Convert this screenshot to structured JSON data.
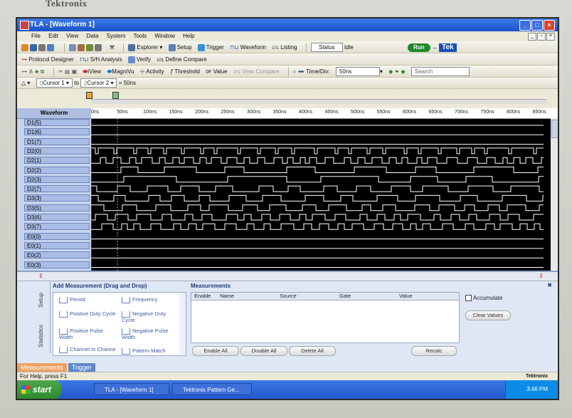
{
  "brand": "Tektronix",
  "window": {
    "title": "TLA - [Waveform 1]"
  },
  "menu": [
    "File",
    "Edit",
    "View",
    "Data",
    "System",
    "Tools",
    "Window",
    "Help"
  ],
  "toolbar1": {
    "explorer": "Explorer",
    "setup": "Setup",
    "trigger": "Trigger",
    "waveform": "Waveform",
    "listing": "Listing",
    "status_label": "Status",
    "status_value": "Idle",
    "run": "Run",
    "tek": "Tek"
  },
  "toolbar2": {
    "protocol": "Protocol Designer",
    "sh_analysis": "S/H Analysis",
    "verify": "Verify",
    "define_compare": "Define Compare"
  },
  "toolbar3": {
    "view": "iView",
    "magnivu": "MagniVu",
    "activity": "Activity",
    "threshold": "Threshold",
    "value": "Value",
    "view_compare": "View Compare",
    "time_div_label": "Time/Div:",
    "time_div_value": "50ns",
    "search": "Search"
  },
  "toolbar4": {
    "cursor1": "Cursor 1",
    "to": "to",
    "cursor2": "Cursor 2",
    "delta": "= 50ns"
  },
  "waveform": {
    "header": "Waveform",
    "ticks": [
      "0ns",
      "50ns",
      "100ns",
      "150ns",
      "200ns",
      "250ns",
      "300ns",
      "350ns",
      "400ns",
      "450ns",
      "500ns",
      "550ns",
      "600ns",
      "650ns",
      "700ns",
      "750ns",
      "800ns",
      "850ns"
    ],
    "signals": [
      "D1(5)",
      "D1(6)",
      "D1(7)",
      "D2(0)",
      "D2(1)",
      "D2(2)",
      "D2(3)",
      "D2(7)",
      "D3(3)",
      "D3(5)",
      "D3(6)",
      "D3(7)",
      "E0(0)",
      "E0(1)",
      "E0(2)",
      "E0(3)"
    ]
  },
  "measure": {
    "add_title": "Add Measurement (Drag and Drop)",
    "items": [
      "Period",
      "Frequency",
      "Positive Duty Cycle",
      "Negative Duty Cycle",
      "Positive Pulse Width",
      "Negative Pulse Width",
      "Channel to Channel Delay",
      "Pattern Match"
    ],
    "meas_title": "Measurements",
    "columns": [
      "Enable",
      "Name",
      "Source",
      "Gate",
      "Value"
    ],
    "enable_all": "Enable All",
    "disable_all": "Disable All",
    "delete_all": "Delete All",
    "recalc": "Recalc",
    "accumulate": "Accumulate",
    "clear_values": "Clear Values",
    "side_tabs": [
      "Setup",
      "Statistics"
    ]
  },
  "tabs": [
    "Measurements",
    "Trigger"
  ],
  "status": {
    "text": "For Help, press F1",
    "right": "Tektronix"
  },
  "taskbar": {
    "start": "start",
    "tasks": [
      "TLA - [Waveform 1]",
      "Tektronix Pattern Ge..."
    ],
    "time": "3:46 PM"
  }
}
